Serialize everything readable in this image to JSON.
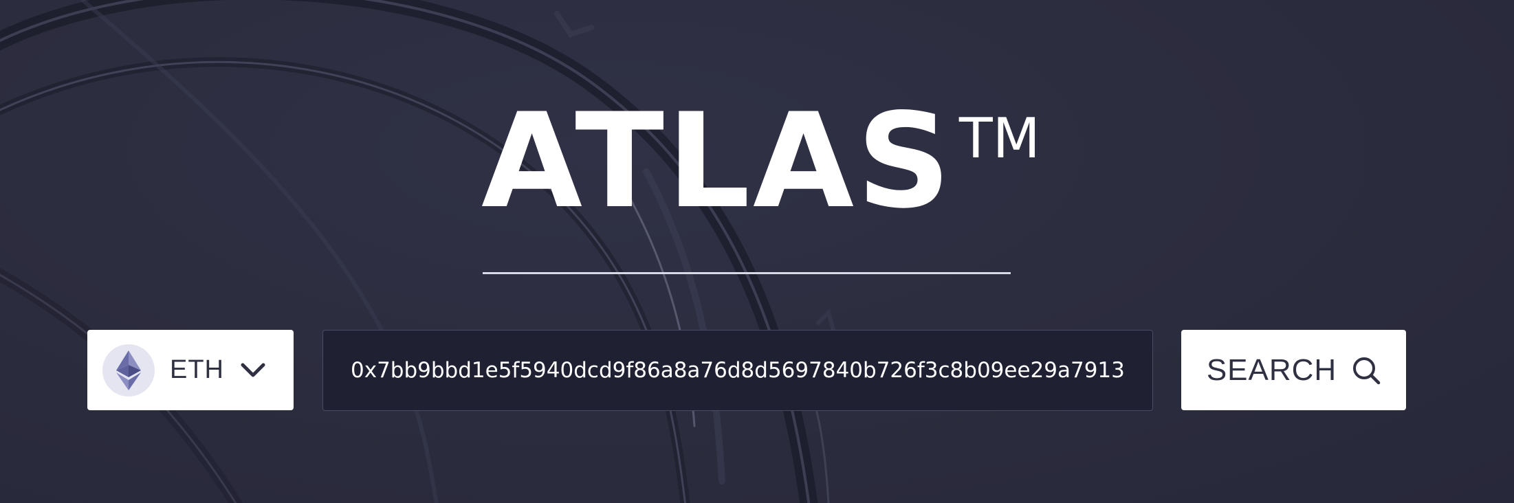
{
  "brand": {
    "name": "ATLAS",
    "trademark": "TM"
  },
  "chain_selector": {
    "icon": "ethereum-icon",
    "selected": "ETH",
    "dropdown_icon": "chevron-down-icon"
  },
  "search": {
    "value": "0x7bb9bbd1e5f5940dcd9f86a8a76d8d5697840b726f3c8b09ee29a7913",
    "button_label": "SEARCH",
    "button_icon": "search-icon"
  },
  "colors": {
    "background": "#2c2d3f",
    "input_background": "#1f2032",
    "text_light": "#ffffff",
    "text_dark": "#2f3042"
  }
}
